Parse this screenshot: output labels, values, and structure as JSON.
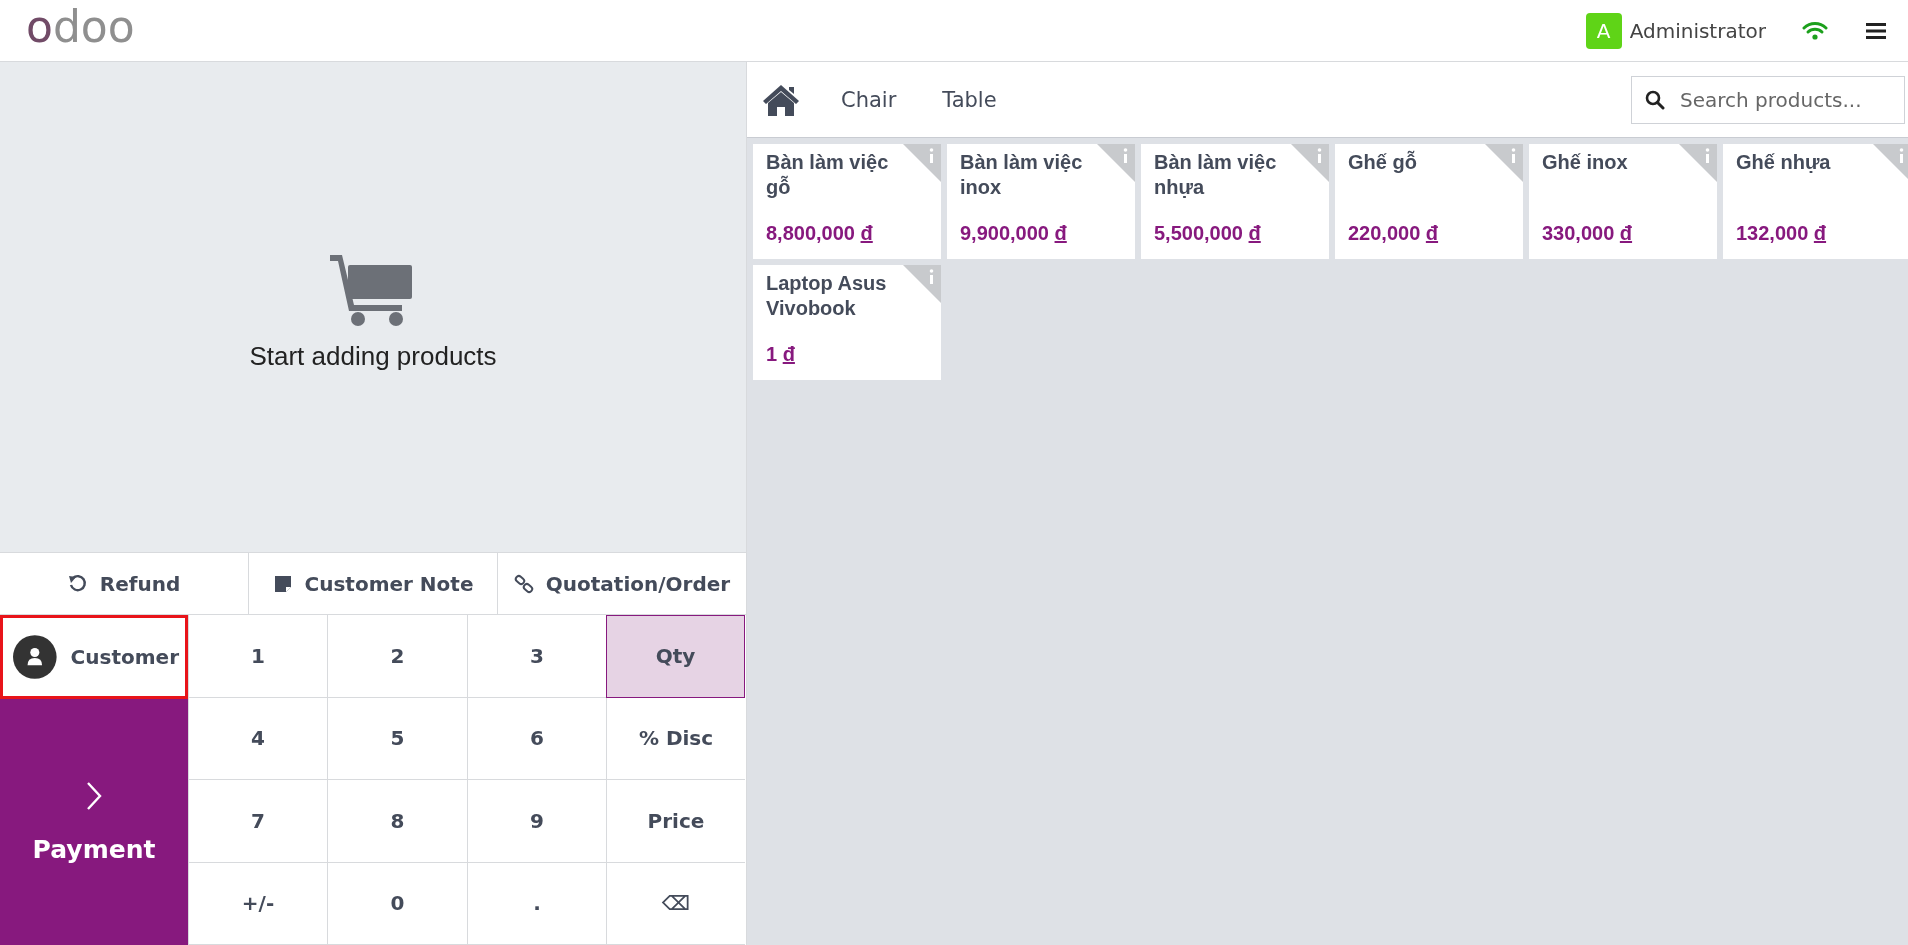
{
  "header": {
    "logo": "odoo",
    "user": {
      "initial": "A",
      "name": "Administrator"
    }
  },
  "order": {
    "empty_message": "Start adding products"
  },
  "control_buttons": [
    {
      "kind": "refund",
      "label": "Refund"
    },
    {
      "kind": "note",
      "label": "Customer Note"
    },
    {
      "kind": "link",
      "label": "Quotation/Order"
    }
  ],
  "customer_button": {
    "label": "Customer",
    "highlighted": true
  },
  "payment_button": {
    "label": "Payment"
  },
  "numpad": [
    {
      "label": "1",
      "kind": "digit"
    },
    {
      "label": "2",
      "kind": "digit"
    },
    {
      "label": "3",
      "kind": "digit"
    },
    {
      "label": "Qty",
      "kind": "mode",
      "selected": true
    },
    {
      "label": "4",
      "kind": "digit"
    },
    {
      "label": "5",
      "kind": "digit"
    },
    {
      "label": "6",
      "kind": "digit"
    },
    {
      "label": "% Disc",
      "kind": "mode",
      "selected": false
    },
    {
      "label": "7",
      "kind": "digit"
    },
    {
      "label": "8",
      "kind": "digit"
    },
    {
      "label": "9",
      "kind": "digit"
    },
    {
      "label": "Price",
      "kind": "mode",
      "selected": false
    },
    {
      "label": "+/-",
      "kind": "digit"
    },
    {
      "label": "0",
      "kind": "digit"
    },
    {
      "label": ".",
      "kind": "digit"
    },
    {
      "label": "⌫",
      "kind": "digit"
    }
  ],
  "categories": [
    {
      "label": "Chair"
    },
    {
      "label": "Table"
    }
  ],
  "search": {
    "placeholder": "Search products..."
  },
  "products": [
    {
      "name": "Bàn làm việc gỗ",
      "price": "8,800,000",
      "currency": "đ"
    },
    {
      "name": "Bàn làm việc inox",
      "price": "9,900,000",
      "currency": "đ"
    },
    {
      "name": "Bàn làm việc nhựa",
      "price": "5,500,000",
      "currency": "đ"
    },
    {
      "name": "Ghế gỗ",
      "price": "220,000",
      "currency": "đ"
    },
    {
      "name": "Ghế inox",
      "price": "330,000",
      "currency": "đ"
    },
    {
      "name": "Ghế nhựa",
      "price": "132,000",
      "currency": "đ"
    },
    {
      "name": "Laptop Asus Vivobook",
      "price": "1",
      "currency": "đ"
    }
  ]
}
